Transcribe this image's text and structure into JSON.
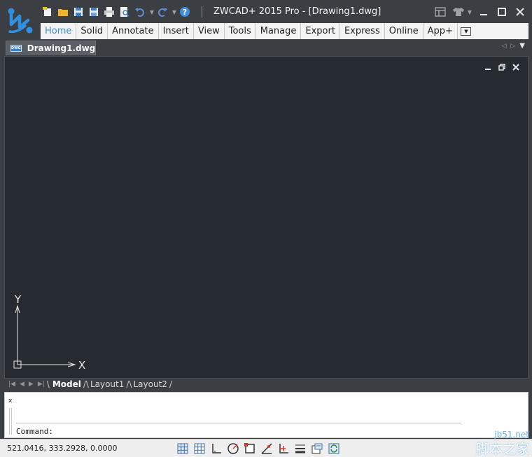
{
  "window": {
    "title": "ZWCAD+ 2015 Pro - [Drawing1.dwg]"
  },
  "quick_access": {
    "icons": [
      "new-file-icon",
      "open-folder-icon",
      "save-icon",
      "save-as-icon",
      "print-icon",
      "print-preview-icon",
      "undo-icon",
      "redo-icon",
      "help-icon"
    ]
  },
  "ribbon": {
    "tabs": [
      {
        "label": "Home",
        "active": true
      },
      {
        "label": "Solid",
        "active": false
      },
      {
        "label": "Annotate",
        "active": false
      },
      {
        "label": "Insert",
        "active": false
      },
      {
        "label": "View",
        "active": false
      },
      {
        "label": "Tools",
        "active": false
      },
      {
        "label": "Manage",
        "active": false
      },
      {
        "label": "Export",
        "active": false
      },
      {
        "label": "Express",
        "active": false
      },
      {
        "label": "Online",
        "active": false
      },
      {
        "label": "App+",
        "active": false
      }
    ]
  },
  "document": {
    "tab_label": "Drawing1.dwg",
    "tab_icon_text": "DWG"
  },
  "ucs": {
    "x_label": "X",
    "y_label": "Y"
  },
  "layout_tabs": [
    {
      "label": "Model",
      "active": true
    },
    {
      "label": "Layout1",
      "active": false
    },
    {
      "label": "Layout2",
      "active": false
    }
  ],
  "command": {
    "close_label": "x",
    "prompt": "Command:"
  },
  "status": {
    "coordinates": "521.0416,  333.2928, 0.0000"
  },
  "watermark": {
    "url": "jb51.net",
    "text": "脚本之家"
  },
  "colors": {
    "canvas": "#262a31",
    "chrome": "#3b3f44",
    "accent": "#3b8fd8",
    "ucs": "#e6e6e6"
  }
}
